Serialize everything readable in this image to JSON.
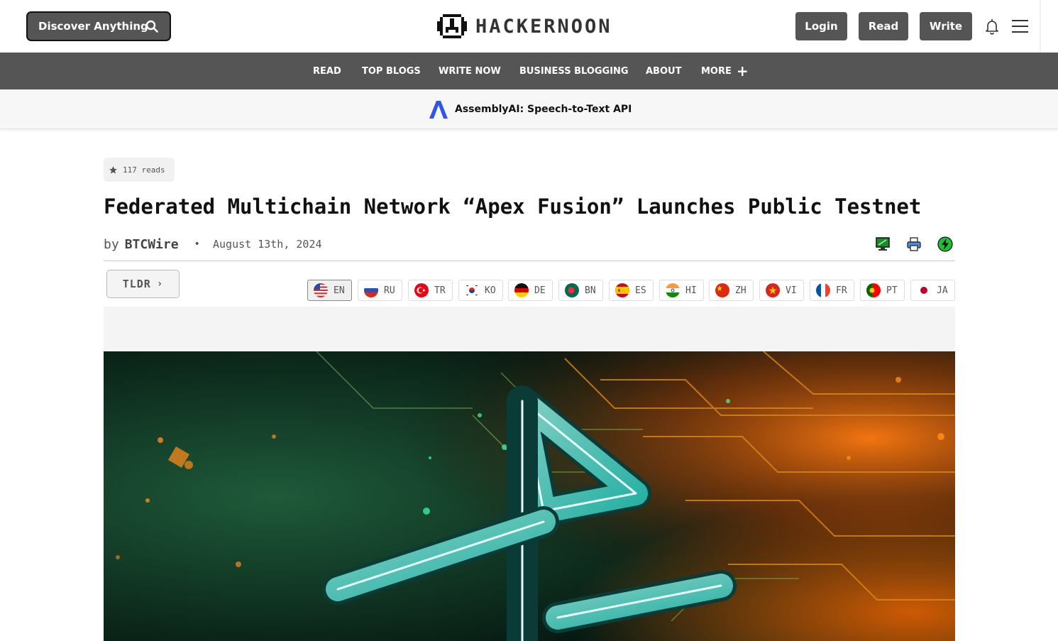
{
  "header": {
    "search_button": "Discover Anything",
    "logo_text": "HACKERNOON",
    "login": "Login",
    "read": "Read",
    "write": "Write"
  },
  "nav": {
    "items": [
      "READ",
      "TOP BLOGS",
      "WRITE NOW",
      "BUSINESS BLOGGING",
      "ABOUT",
      "MORE"
    ]
  },
  "sponsor": {
    "text": "AssemblyAI: Speech-to-Text API"
  },
  "article": {
    "reads": "117 reads",
    "title": "Federated Multichain Network “Apex Fusion” Launches Public Testnet",
    "by": "by",
    "author": "BTCWire",
    "separator": "•",
    "date": "August 13th, 2024",
    "tldr": "TLDR"
  },
  "languages": [
    {
      "code": "EN",
      "active": true
    },
    {
      "code": "RU"
    },
    {
      "code": "TR"
    },
    {
      "code": "KO"
    },
    {
      "code": "DE"
    },
    {
      "code": "BN"
    },
    {
      "code": "ES"
    },
    {
      "code": "HI"
    },
    {
      "code": "ZH"
    },
    {
      "code": "VI"
    },
    {
      "code": "FR"
    },
    {
      "code": "PT"
    },
    {
      "code": "JA"
    }
  ],
  "icons": {
    "search": "search-icon",
    "bell": "bell-icon",
    "menu": "hamburger-menu-icon",
    "star": "star-icon",
    "monitor": "monitor-icon",
    "print": "printer-icon",
    "bolt": "lightning-icon"
  },
  "colors": {
    "header_button": "#555555",
    "nav_background": "#555555",
    "sponsor_background": "#f7f7f7",
    "accent_green": "#1fbf2f"
  }
}
